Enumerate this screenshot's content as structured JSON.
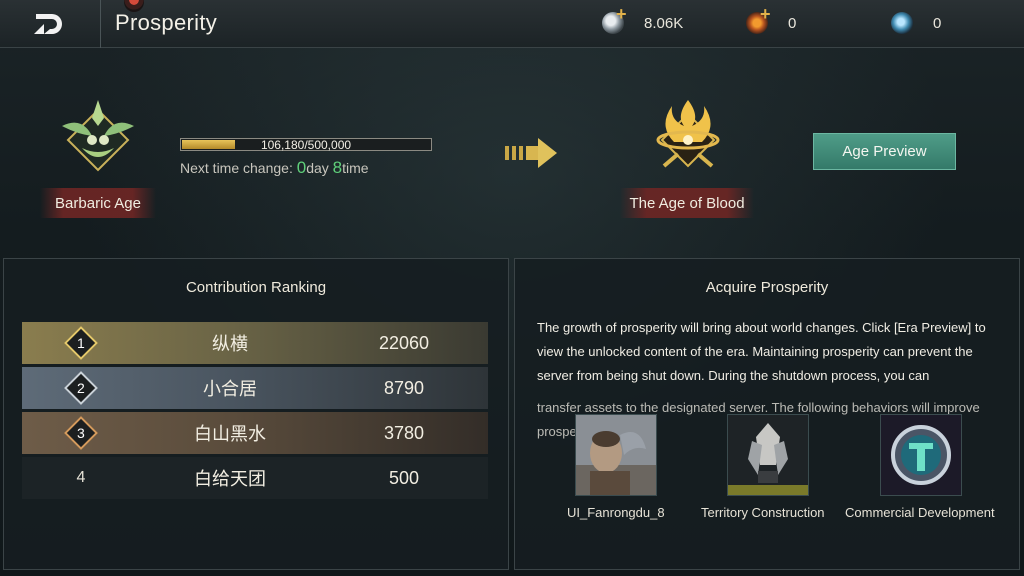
{
  "header": {
    "title": "Prosperity",
    "resources": [
      {
        "icon": "silver-coin-icon",
        "value": "8.06K"
      },
      {
        "icon": "gold-coin-icon",
        "value": "0"
      },
      {
        "icon": "gem-icon",
        "value": "0"
      }
    ]
  },
  "current_age": {
    "label": "Barbaric Age",
    "progress_text": "106,180/500,000",
    "progress_fraction": 0.2124,
    "next_change_prefix": "Next time change: ",
    "days": "0",
    "days_unit": "day ",
    "times": "8",
    "times_unit": "time"
  },
  "next_age": {
    "label": "The Age of Blood"
  },
  "age_preview_button": "Age Preview",
  "ranking": {
    "title": "Contribution Ranking",
    "rows": [
      {
        "rank": "1",
        "name": "纵横",
        "score": "22060"
      },
      {
        "rank": "2",
        "name": "小合居",
        "score": "8790"
      },
      {
        "rank": "3",
        "name": "白山黑水",
        "score": "3780"
      },
      {
        "rank": "4",
        "name": "白给天团",
        "score": "500"
      }
    ]
  },
  "acquire": {
    "title": "Acquire Prosperity",
    "description": "The growth of prosperity will bring about world changes. Click [Era Preview] to view the unlocked content of the era. Maintaining prosperity can prevent the server from being shut down. During the shutdown process, you can",
    "description_overlap": "transfer assets to the designated server. The following behaviors will improve prosperity: Spend:",
    "actions": [
      {
        "label": "UI_Fanrongdu_8",
        "icon": "warrior-portrait-icon"
      },
      {
        "label": "Territory Construction",
        "icon": "construction-icon"
      },
      {
        "label": "Commercial Development",
        "icon": "commerce-coin-icon"
      }
    ]
  }
}
